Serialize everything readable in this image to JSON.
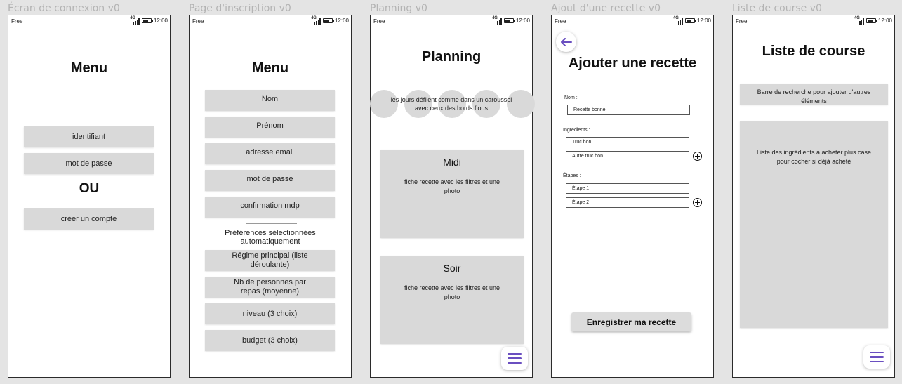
{
  "status_bar": {
    "carrier": "Free",
    "network": "4G",
    "time": "12:00"
  },
  "screens": {
    "login": {
      "frame_title": "Écran de connexion v0",
      "title": "Menu",
      "identifier": "identifiant",
      "password": "mot de passe",
      "or": "OU",
      "create_account": "créer un compte"
    },
    "signup": {
      "frame_title": "Page d'inscription v0",
      "title": "Menu",
      "fields": [
        "Nom",
        "Prénom",
        "adresse email",
        "mot de passe",
        "confirmation mdp"
      ],
      "preferences_line1": "Préférences sélectionnées",
      "preferences_line2": "automatiquement",
      "preferences": [
        [
          "Régime principal (liste",
          "déroulante)"
        ],
        [
          "Nb de personnes par",
          "repas (moyenne)"
        ],
        [
          "niveau (3 choix)"
        ],
        [
          "budget (3 choix)"
        ]
      ]
    },
    "planning": {
      "frame_title": "Planning v0",
      "title": "Planning",
      "carousel_line1": "les jours défilent comme dans un caroussel",
      "carousel_line2": "avec ceux des bords flous",
      "lunch_title": "Midi",
      "dinner_title": "Soir",
      "recipe_desc_line1": "fiche recette avec les filtres et une",
      "recipe_desc_line2": "photo"
    },
    "add_recipe": {
      "frame_title": "Ajout d'une recette v0",
      "title": "Ajouter une recette",
      "name_label": "Nom :",
      "name_value": "Recette bonne",
      "ingredients_label": "Ingrédients :",
      "ingredients": [
        "Truc bon",
        "Autre truc bon"
      ],
      "steps_label": "Étapes :",
      "steps": [
        "Étape 1",
        "Étape 2"
      ],
      "save_label": "Enregistrer ma recette"
    },
    "shopping_list": {
      "frame_title": "Liste de course v0",
      "title": "Liste de course",
      "search_line1": "Barre de recherche pour ajouter d'autres",
      "search_line2": "éléments",
      "list_line1": "Liste des ingrédients à acheter plus case",
      "list_line2": "pour cocher si déjà acheté"
    }
  },
  "colors": {
    "accent": "#6a4fc0",
    "placeholder_gray": "#d9d9d9",
    "canvas": "#e4e4e4"
  },
  "icons": {
    "back": "arrow-left-icon",
    "menu": "hamburger-menu-icon",
    "add": "plus-circle-icon",
    "signal": "signal-icon",
    "battery": "battery-icon"
  }
}
